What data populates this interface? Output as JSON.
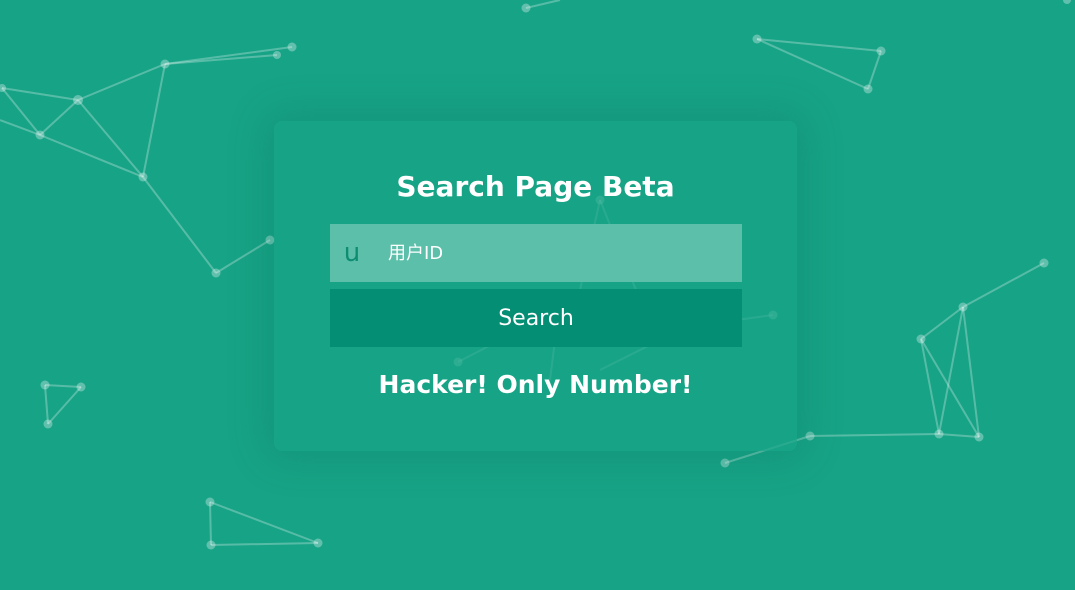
{
  "page": {
    "title": "Search Page Beta",
    "message": "Hacker! Only Number!"
  },
  "search": {
    "icon_glyph": "u",
    "icon_name": "user-icon",
    "placeholder": "用户ID",
    "value": "",
    "button_label": "Search"
  },
  "colors": {
    "background": "#17a386",
    "input_background": "#5cbfaa",
    "button_background": "#048f74",
    "text": "#ffffff"
  }
}
